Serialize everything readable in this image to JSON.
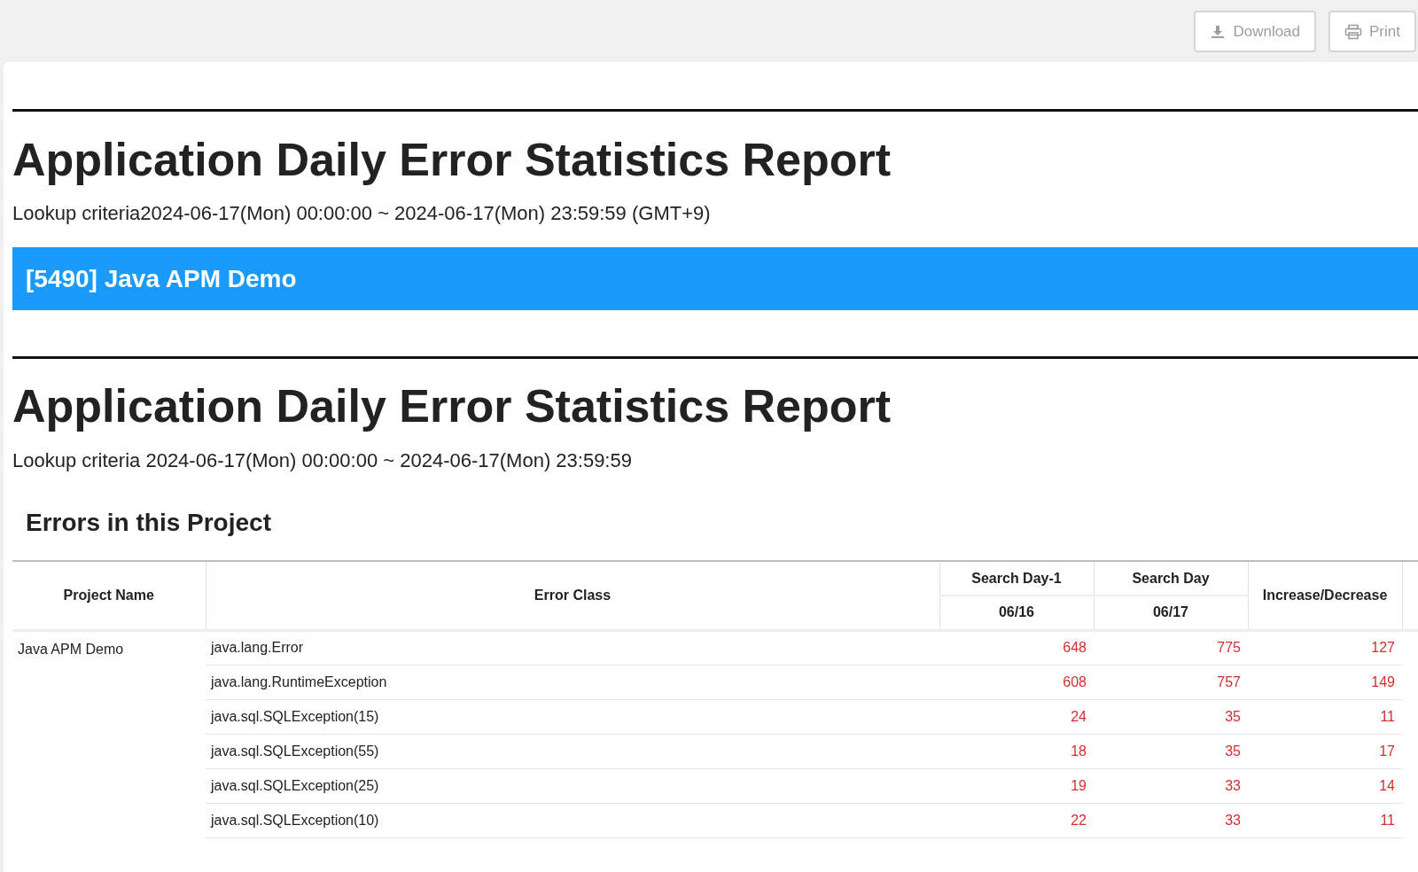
{
  "toolbar": {
    "buttons": [
      {
        "kind": "download",
        "label": "Download"
      },
      {
        "kind": "print",
        "label": "Print"
      }
    ]
  },
  "report_header": {
    "title": "Application Daily Error Statistics Report",
    "criteria": "Lookup criteria2024-06-17(Mon) 00:00:00 ~ 2024-06-17(Mon) 23:59:59 (GMT+9)"
  },
  "project_banner": "[5490] Java APM Demo",
  "report": {
    "title": "Application Daily Error Statistics Report",
    "criteria": "Lookup criteria 2024-06-17(Mon) 00:00:00 ~ 2024-06-17(Mon) 23:59:59",
    "section_title": "Errors in this Project",
    "table": {
      "columns": {
        "project_name": "Project Name",
        "error_class": "Error Class",
        "search_day_minus_1": "Search Day-1",
        "search_day_minus_1_date": "06/16",
        "search_day": "Search Day",
        "search_day_date": "06/17",
        "increase_decrease": "Increase/Decrease"
      },
      "groups": [
        {
          "project_name": "Java APM Demo",
          "rows": [
            {
              "error_class": "java.lang.Error",
              "day_minus_1": "648",
              "day": "775",
              "change": "127"
            },
            {
              "error_class": "java.lang.RuntimeException",
              "day_minus_1": "608",
              "day": "757",
              "change": "149"
            },
            {
              "error_class": "java.sql.SQLException(15)",
              "day_minus_1": "24",
              "day": "35",
              "change": "11"
            },
            {
              "error_class": "java.sql.SQLException(55)",
              "day_minus_1": "18",
              "day": "35",
              "change": "17"
            },
            {
              "error_class": "java.sql.SQLException(25)",
              "day_minus_1": "19",
              "day": "33",
              "change": "14"
            },
            {
              "error_class": "java.sql.SQLException(10)",
              "day_minus_1": "22",
              "day": "33",
              "change": "11"
            }
          ]
        }
      ]
    }
  }
}
